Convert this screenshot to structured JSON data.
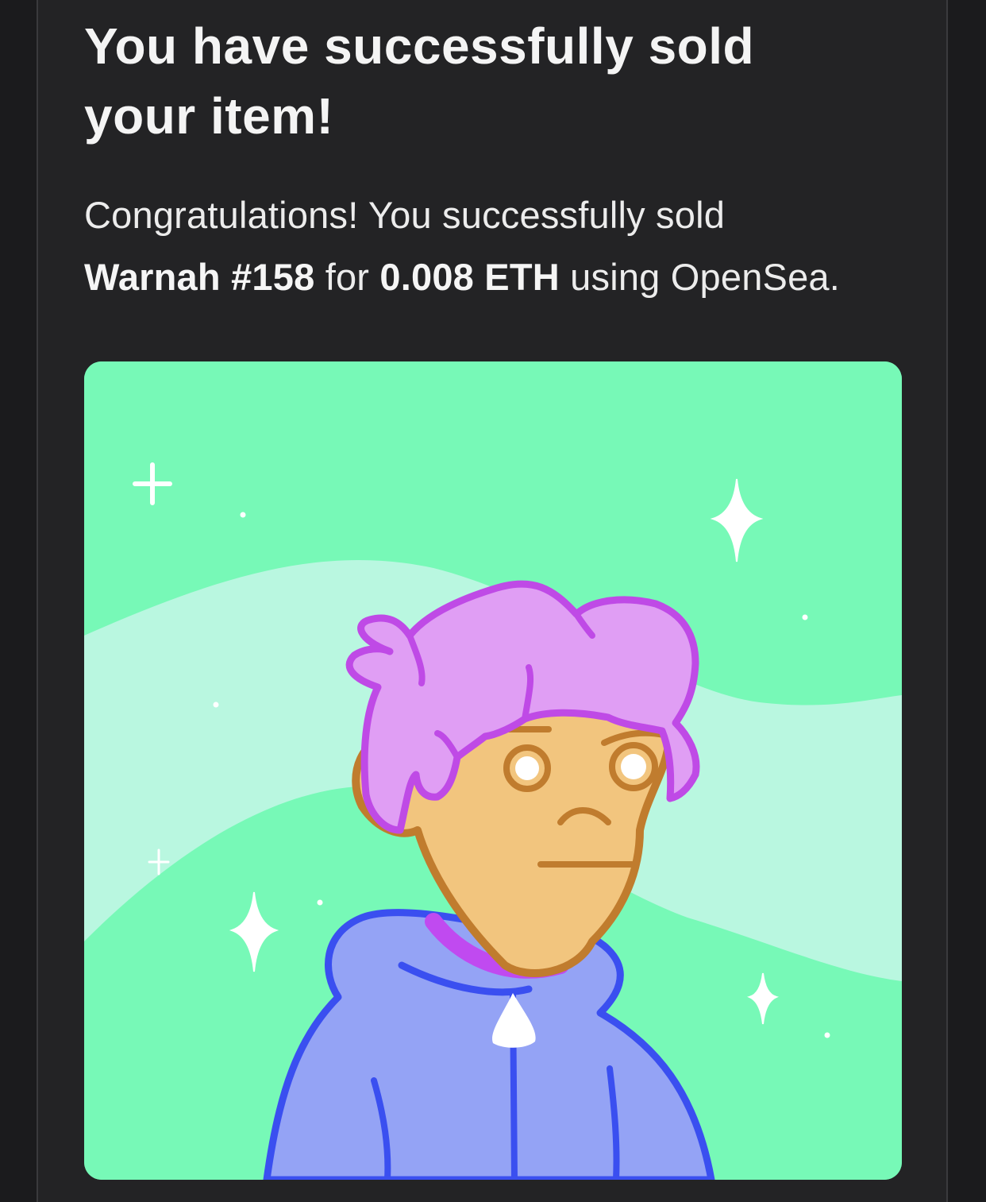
{
  "email": {
    "title": "You have successfully sold your item!",
    "message": {
      "intro": "Congratulations! You successfully sold",
      "item_name": "Warnah #158",
      "for_word": "for",
      "price": "0.008 ETH",
      "outro": "using OpenSea."
    }
  },
  "nft": {
    "image_description_icon": "nft-avatar-image",
    "colors": {
      "background": "#77f9b7",
      "wave": "#b9f7e0",
      "hair": "#e09ef4",
      "skin": "#f2c57e",
      "hoodie": "#94a3f5",
      "outline_blue": "#3a4ff0"
    }
  }
}
